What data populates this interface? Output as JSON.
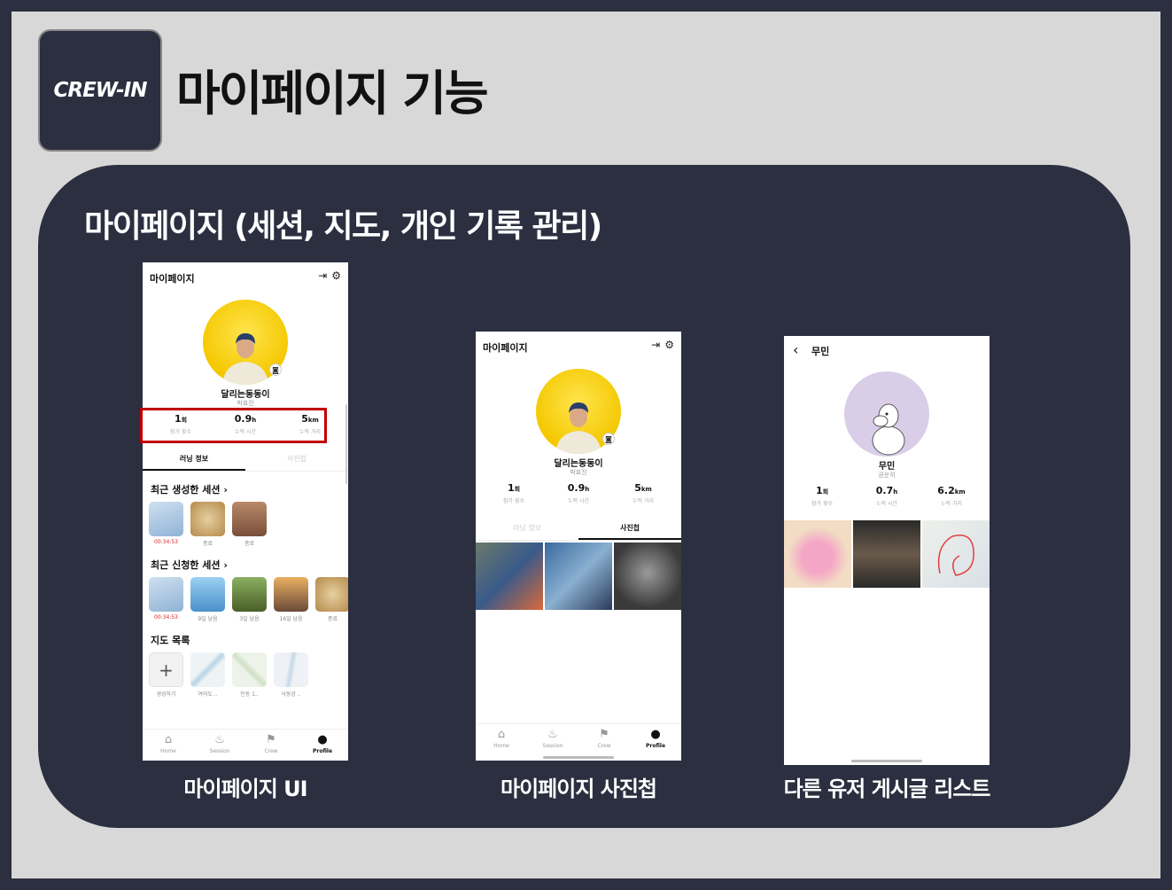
{
  "brand": "CREW-IN",
  "title": "마이페이지 기능",
  "panel_title": "마이페이지 (세션, 지도, 개인 기록 관리)",
  "colors": {
    "background": "#2b2f40",
    "slide": "#d8d8d8",
    "highlight": "#c00000",
    "avatar_yellow": "#f4c800"
  },
  "screens": [
    {
      "caption": "마이페이지 UI",
      "header": "마이페이지",
      "icons": [
        "logout-icon",
        "gear-icon"
      ],
      "nickname": "달리는동동이",
      "realname": "박효진",
      "stats": [
        {
          "value": "1",
          "unit": "회",
          "label": "참가 횟수"
        },
        {
          "value": "0.9",
          "unit": "h",
          "label": "누적 시간"
        },
        {
          "value": "5",
          "unit": "km",
          "label": "누적 거리"
        }
      ],
      "tabs": [
        "러닝 정보",
        "사진첩"
      ],
      "sections": {
        "created": {
          "title": "최근 생성한 세션",
          "items": [
            {
              "caption": "00:34:53",
              "color": "#a7c4e0"
            },
            {
              "caption": "종료",
              "color": "#c9a36a"
            },
            {
              "caption": "종료",
              "color": "#9a6a4e"
            }
          ]
        },
        "applied": {
          "title": "최근 신청한 세션",
          "items": [
            {
              "caption": "00:34:53",
              "color": "#a7c4e0"
            },
            {
              "caption": "9일 남음",
              "color": "#6aa9d8"
            },
            {
              "caption": "3일 남음",
              "color": "#5e7a3a"
            },
            {
              "caption": "16일 남음",
              "color": "#c68a3a"
            },
            {
              "caption": "종료",
              "color": "#c9a36a"
            }
          ]
        },
        "maps": {
          "title": "지도 목록",
          "items": [
            {
              "caption": "생성하기",
              "plus": "+"
            },
            {
              "caption": "여의도 ..",
              "color": "#e3ecf0"
            },
            {
              "caption": "인동 1..",
              "color": "#e6efe1"
            },
            {
              "caption": "낙동강 ..",
              "color": "#e8eef4"
            }
          ]
        }
      },
      "nav": [
        "Home",
        "Session",
        "Crew",
        "Profile"
      ]
    },
    {
      "caption": "마이페이지 사진첩",
      "header": "마이페이지",
      "nickname": "달리는동동이",
      "realname": "박효진",
      "stats": [
        {
          "value": "1",
          "unit": "회",
          "label": "참가 횟수"
        },
        {
          "value": "0.9",
          "unit": "h",
          "label": "누적 시간"
        },
        {
          "value": "5",
          "unit": "km",
          "label": "누적 거리"
        }
      ],
      "tabs": [
        "러닝 정보",
        "사진첩"
      ],
      "nav": [
        "Home",
        "Session",
        "Crew",
        "Profile"
      ]
    },
    {
      "caption": "다른 유저 게시글 리스트",
      "header": "무민",
      "nickname": "무민",
      "realname": "권운히",
      "stats": [
        {
          "value": "1",
          "unit": "회",
          "label": "참가 횟수"
        },
        {
          "value": "0.7",
          "unit": "h",
          "label": "누적 시간"
        },
        {
          "value": "6.2",
          "unit": "km",
          "label": "누적 거리"
        }
      ]
    }
  ]
}
